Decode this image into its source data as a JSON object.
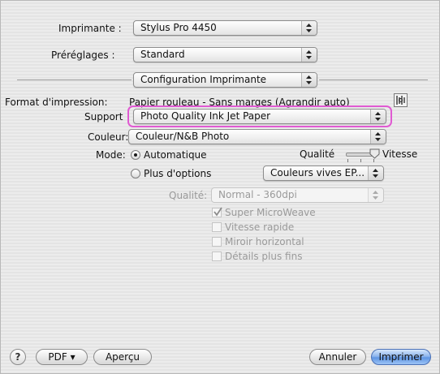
{
  "printer": {
    "label": "Imprimante :",
    "value": "Stylus Pro 4450"
  },
  "presets": {
    "label": "Préréglages :",
    "value": "Standard"
  },
  "panel": {
    "value": "Configuration Imprimante"
  },
  "paper_format": {
    "label": "Format d'impression:",
    "value": "Papier rouleau - Sans marges (Agrandir auto)"
  },
  "support": {
    "label": "Support",
    "value": "Photo Quality Ink Jet Paper"
  },
  "color": {
    "label": "Couleur:",
    "value": "Couleur/N&B Photo"
  },
  "mode": {
    "label": "Mode:",
    "automatic_label": "Automatique",
    "automatic_selected": true,
    "more_options_label": "Plus d'options",
    "more_options_selected": false,
    "quality_label": "Qualité",
    "speed_label": "Vitesse",
    "speed_quality_level": 1.0,
    "color_mode_value": "Couleurs vives EP..."
  },
  "advanced": {
    "quality_label": "Qualité:",
    "quality_value": "Normal - 360dpi",
    "options": [
      {
        "label": "Super MicroWeave",
        "checked": true
      },
      {
        "label": "Vitesse rapide",
        "checked": false
      },
      {
        "label": "Miroir horizontal",
        "checked": false
      },
      {
        "label": "Détails plus fins",
        "checked": false
      }
    ]
  },
  "footer": {
    "help_label": "?",
    "pdf_label": "PDF ▾",
    "preview_label": "Aperçu",
    "cancel_label": "Annuler",
    "print_label": "Imprimer"
  },
  "colors": {
    "highlight": "#e05ad2",
    "primary_button": "#6fa0e6"
  }
}
